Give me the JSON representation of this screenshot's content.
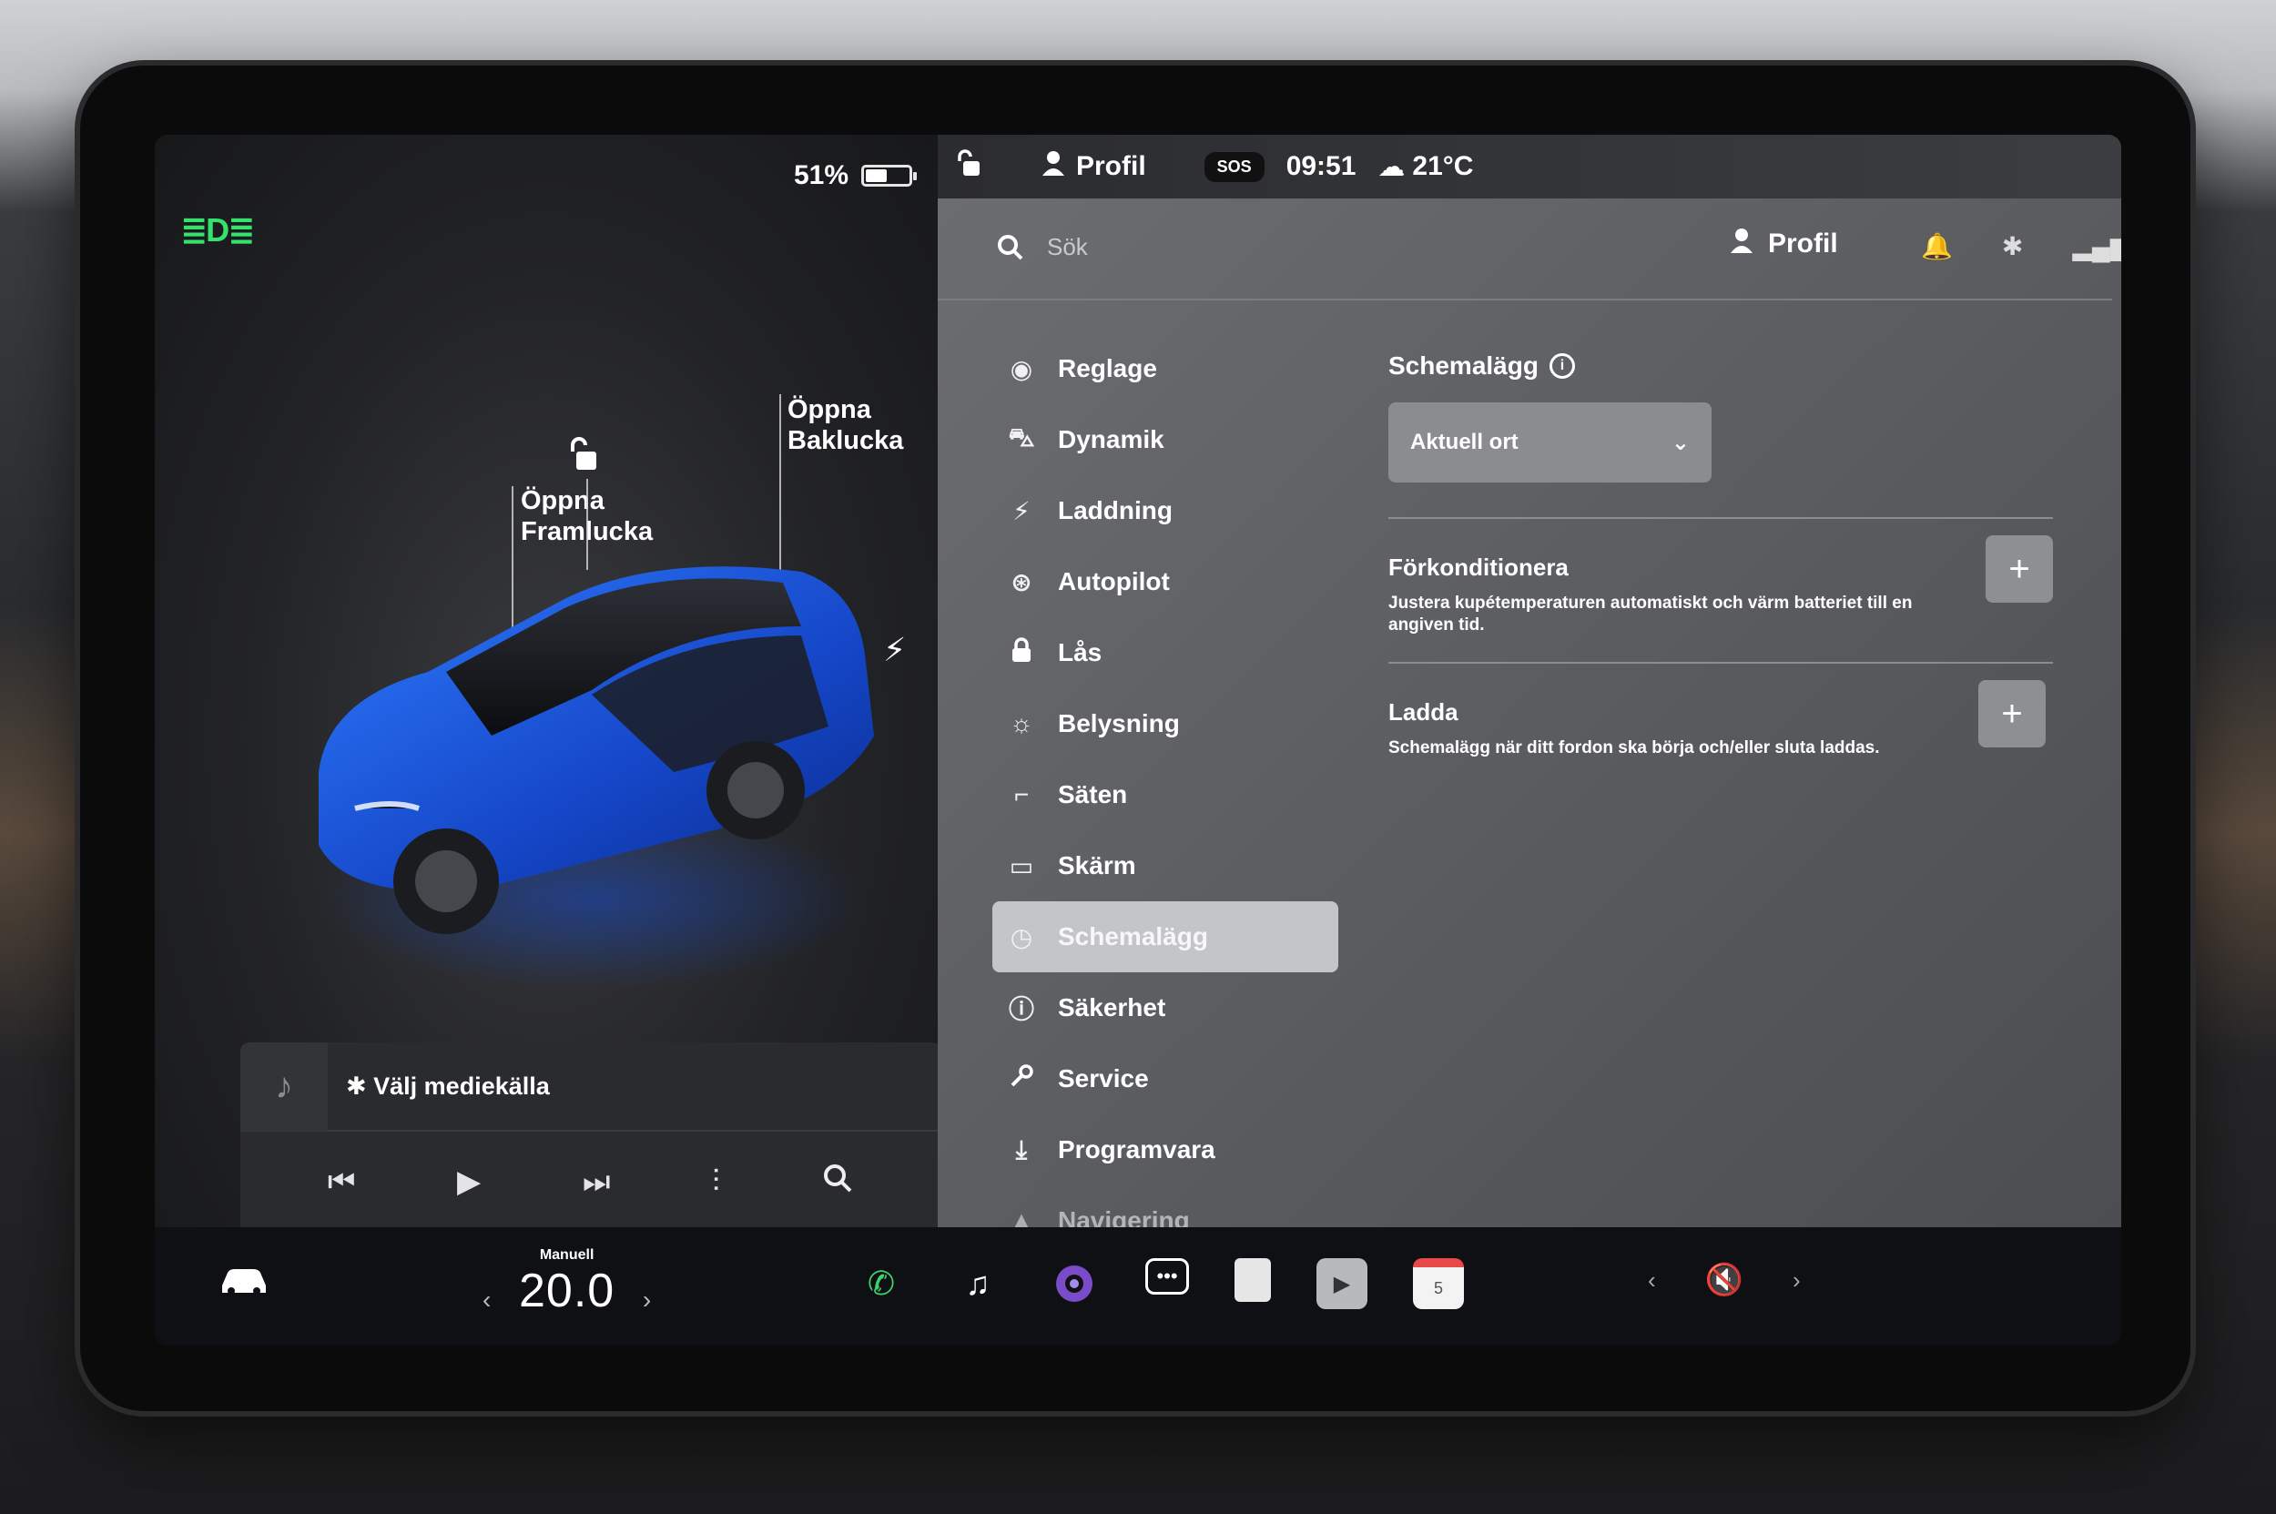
{
  "status": {
    "battery_pct": "51%",
    "battery_level": 0.51,
    "profile": "Profil",
    "sos": "SOS",
    "time": "09:51",
    "temperature": "21°C"
  },
  "car": {
    "label_front": "Öppna\nFramlucka",
    "label_rear": "Öppna\nBaklucka",
    "color": "#1f63e6"
  },
  "media": {
    "source_label": "Välj mediekälla",
    "bluetooth_glyph": "✱"
  },
  "settings": {
    "search_placeholder": "Sök",
    "profile": "Profil",
    "menu": [
      {
        "label": "Reglage",
        "icon": "toggle-icon",
        "glyph": "◉"
      },
      {
        "label": "Dynamik",
        "icon": "car-front-icon",
        "glyph": "⛍"
      },
      {
        "label": "Laddning",
        "icon": "bolt-icon",
        "glyph": "⚡"
      },
      {
        "label": "Autopilot",
        "icon": "steering-wheel-icon",
        "glyph": "⊛"
      },
      {
        "label": "Lås",
        "icon": "lock-icon",
        "glyph": "🔒"
      },
      {
        "label": "Belysning",
        "icon": "sun-icon",
        "glyph": "☼"
      },
      {
        "label": "Säten",
        "icon": "seat-icon",
        "glyph": "⌐"
      },
      {
        "label": "Skärm",
        "icon": "display-icon",
        "glyph": "▭"
      },
      {
        "label": "Schemalägg",
        "icon": "clock-icon",
        "glyph": "◷",
        "active": true
      },
      {
        "label": "Säkerhet",
        "icon": "alert-circle-icon",
        "glyph": "ⓘ"
      },
      {
        "label": "Service",
        "icon": "wrench-icon",
        "glyph": "🔧"
      },
      {
        "label": "Programvara",
        "icon": "download-icon",
        "glyph": "⤓"
      },
      {
        "label": "Navigering",
        "icon": "navigation-icon",
        "glyph": "▲"
      }
    ],
    "schedule": {
      "title": "Schemalägg",
      "location_selected": "Aktuell ort",
      "precondition_title": "Förkonditionera",
      "precondition_desc": "Justera kupétemperaturen automatiskt och värm batteriet till en angiven tid.",
      "charge_title": "Ladda",
      "charge_desc": "Schemalägg när ditt fordon ska börja och/eller sluta laddas."
    }
  },
  "taskbar": {
    "climate_mode": "Manuell",
    "climate_temp": "20.0"
  }
}
